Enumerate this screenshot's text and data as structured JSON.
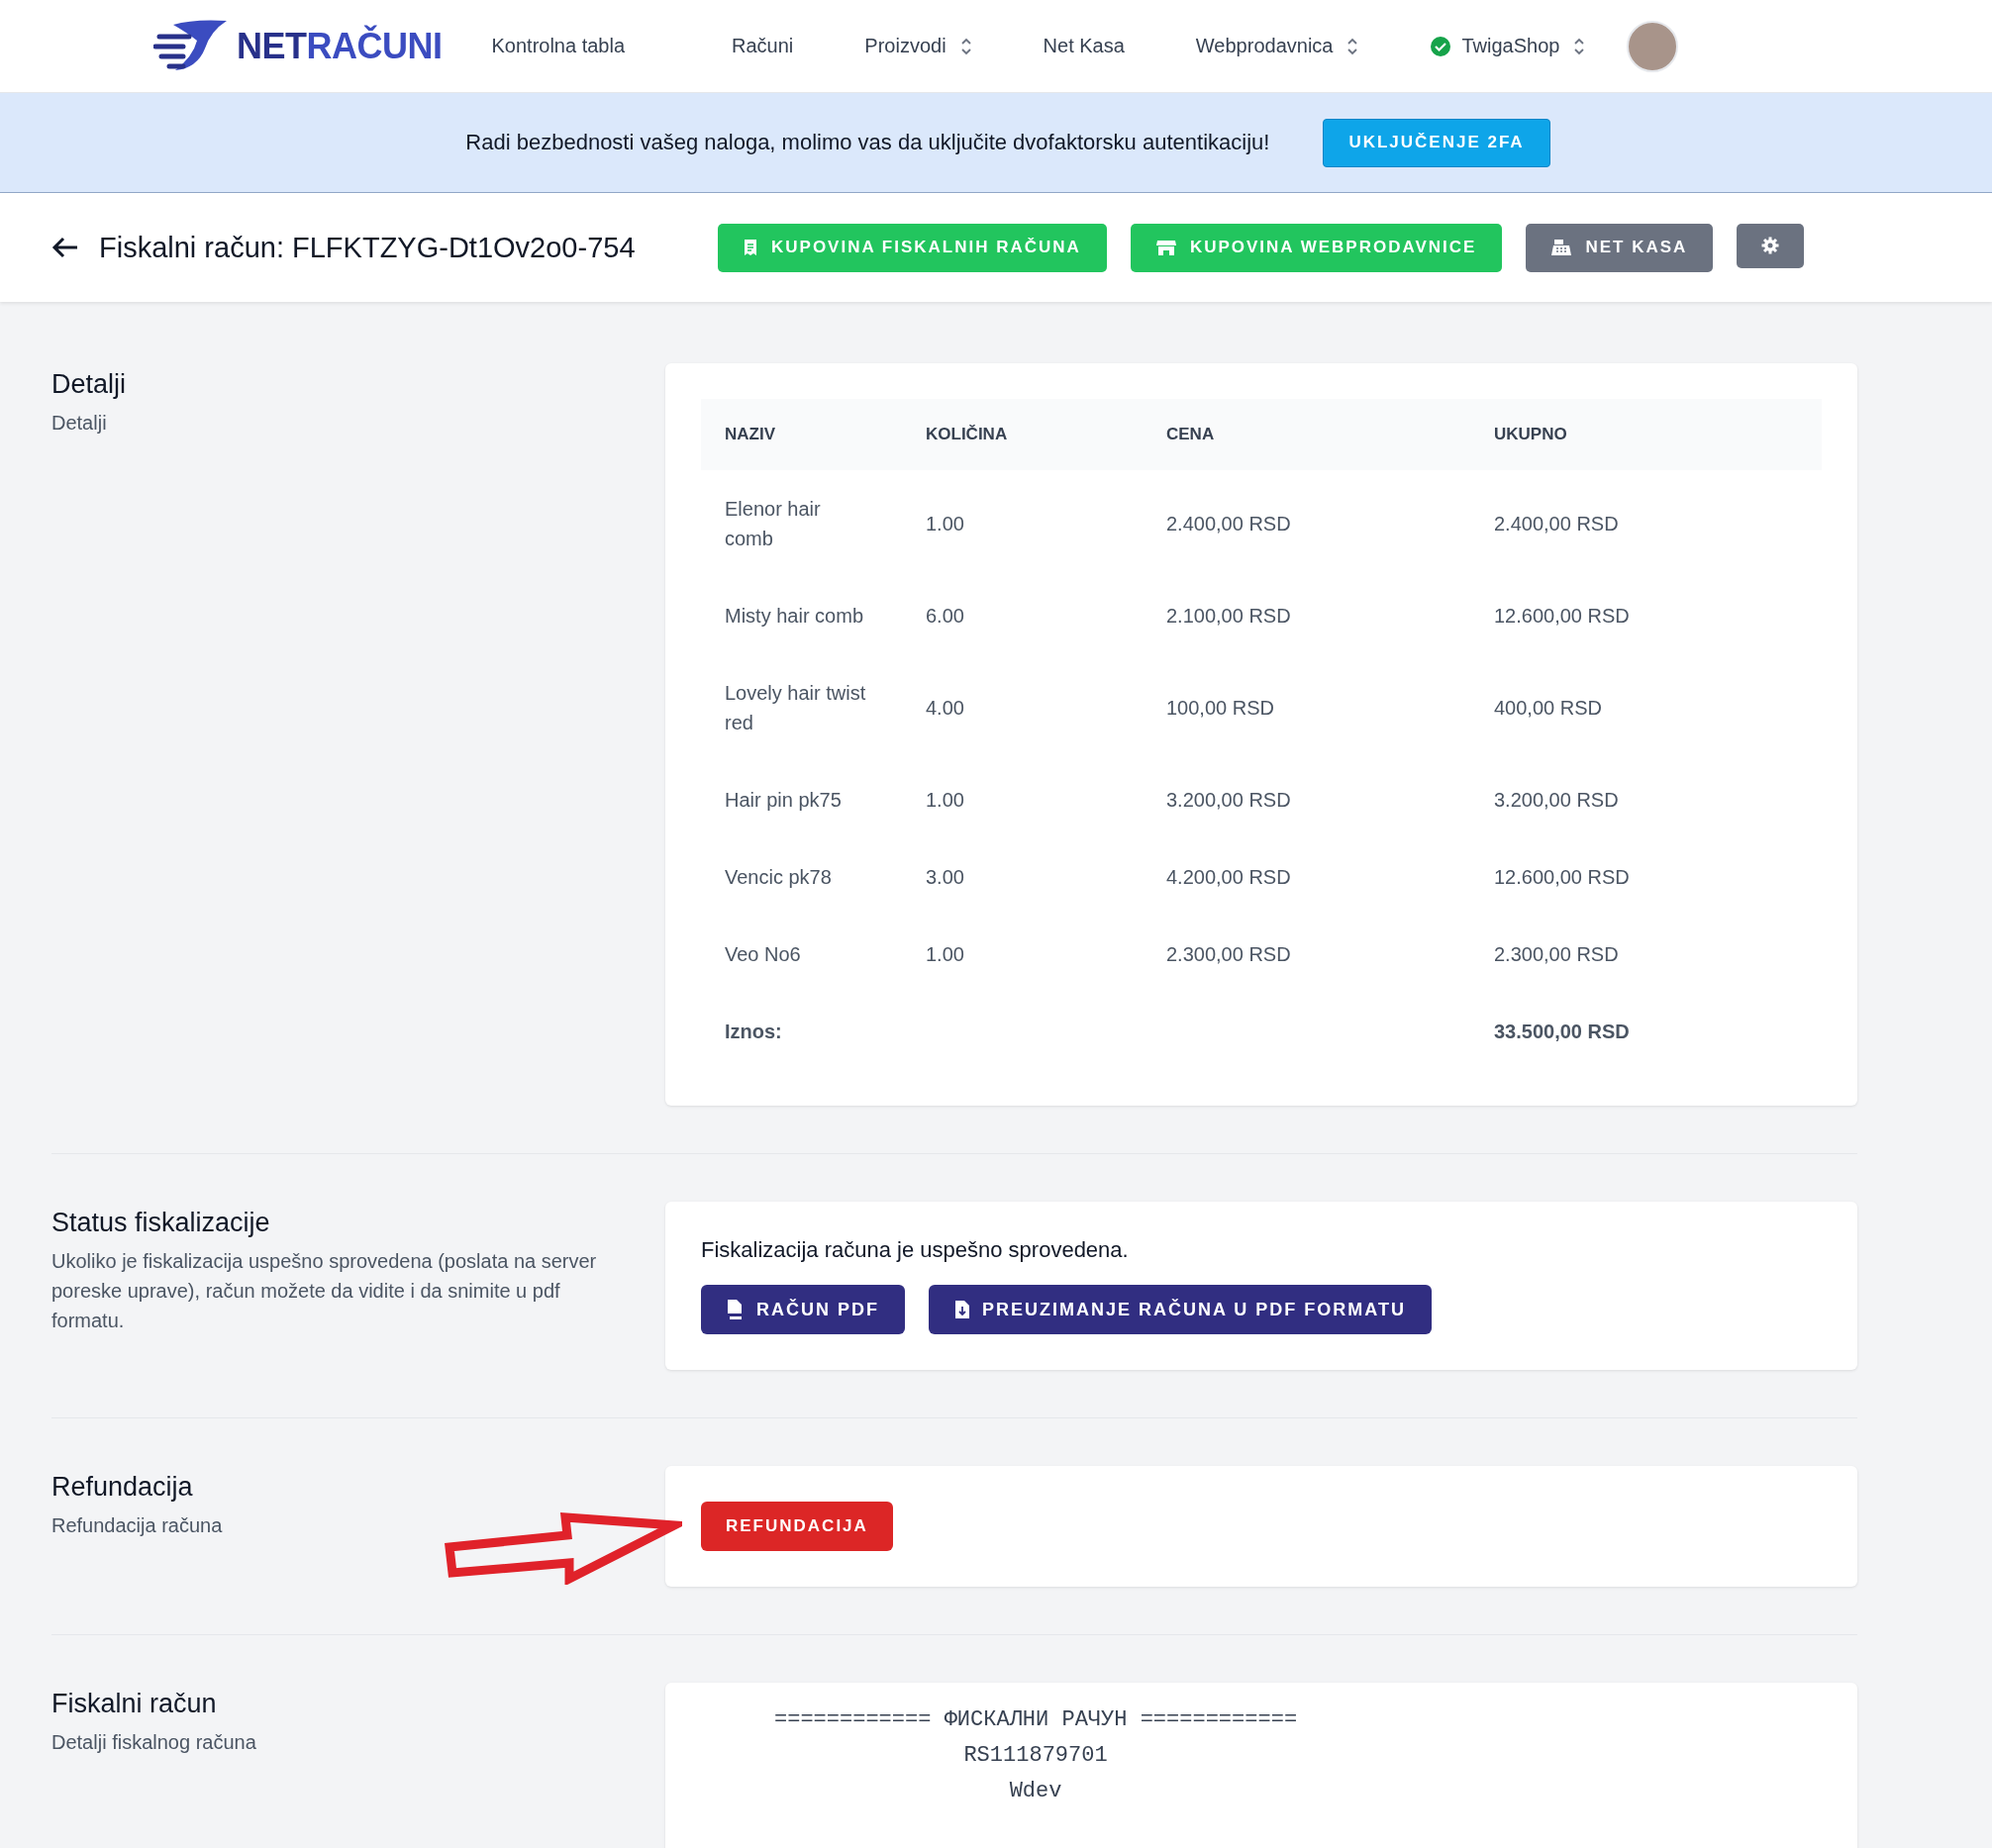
{
  "header": {
    "logo": {
      "parts": [
        "NET",
        "RAČUNI"
      ]
    },
    "nav": [
      {
        "label": "Kontrolna tabla",
        "kind": "link"
      },
      {
        "label": "Računi",
        "kind": "link"
      },
      {
        "label": "Proizvodi",
        "kind": "dropdown"
      },
      {
        "label": "Net Kasa",
        "kind": "link"
      },
      {
        "label": "Webprodavnica",
        "kind": "dropdown"
      }
    ],
    "shop": {
      "label": "TwigaShop",
      "verified": true
    }
  },
  "banner": {
    "message": "Radi bezbednosti vašeg naloga, molimo vas da uključite dvofaktorsku autentikaciju!",
    "button": "UKLJUČENJE 2FA"
  },
  "page": {
    "title": "Fiskalni račun: FLFKTZYG-Dt1Ov2o0-754",
    "actions": [
      {
        "label": "KUPOVINA FISKALNIH RAČUNA",
        "kind": "success"
      },
      {
        "label": "KUPOVINA WEBPRODAVNICE",
        "kind": "success"
      },
      {
        "label": "NET KASA",
        "kind": "secondary"
      },
      {
        "kind": "settings"
      }
    ]
  },
  "sections": [
    {
      "kind": "items",
      "title": "Detalji",
      "description": "Detalji",
      "table": {
        "columns": [
          "NAZIV",
          "KOLIČINA",
          "CENA",
          "UKUPNO"
        ],
        "rows": [
          [
            "Elenor hair comb",
            "1.00",
            "2.400,00 RSD",
            "2.400,00 RSD"
          ],
          [
            "Misty hair comb",
            "6.00",
            "2.100,00 RSD",
            "12.600,00 RSD"
          ],
          [
            "Lovely hair twist red",
            "4.00",
            "100,00 RSD",
            "400,00 RSD"
          ],
          [
            "Hair pin pk75",
            "1.00",
            "3.200,00 RSD",
            "3.200,00 RSD"
          ],
          [
            "Vencic pk78",
            "3.00",
            "4.200,00 RSD",
            "12.600,00 RSD"
          ],
          [
            "Veo No6",
            "1.00",
            "2.300,00 RSD",
            "2.300,00 RSD"
          ]
        ],
        "total": {
          "label": "Iznos:",
          "value": "33.500,00 RSD"
        }
      }
    },
    {
      "kind": "status",
      "title": "Status fiskalizacije",
      "description": "Ukoliko je fiskalizacija uspešno sprovedena (poslata na server poreske uprave), račun možete da vidite i da snimite u pdf formatu.",
      "message": "Fiskalizacija računa je uspešno sprovedena.",
      "buttons": [
        {
          "label": "RAČUN PDF"
        },
        {
          "label": "PREUZIMANJE RAČUNA U PDF FORMATU"
        }
      ]
    },
    {
      "kind": "refund",
      "title": "Refundacija",
      "description": "Refundacija računa",
      "button": "REFUNDACIJA"
    },
    {
      "kind": "receipt",
      "title": "Fiskalni račun",
      "description": "Detalji fiskalnog računa",
      "lines": [
        "============ ФИСКАЛНИ РАЧУН ============",
        "RS111879701",
        "Wdev"
      ]
    }
  ]
}
